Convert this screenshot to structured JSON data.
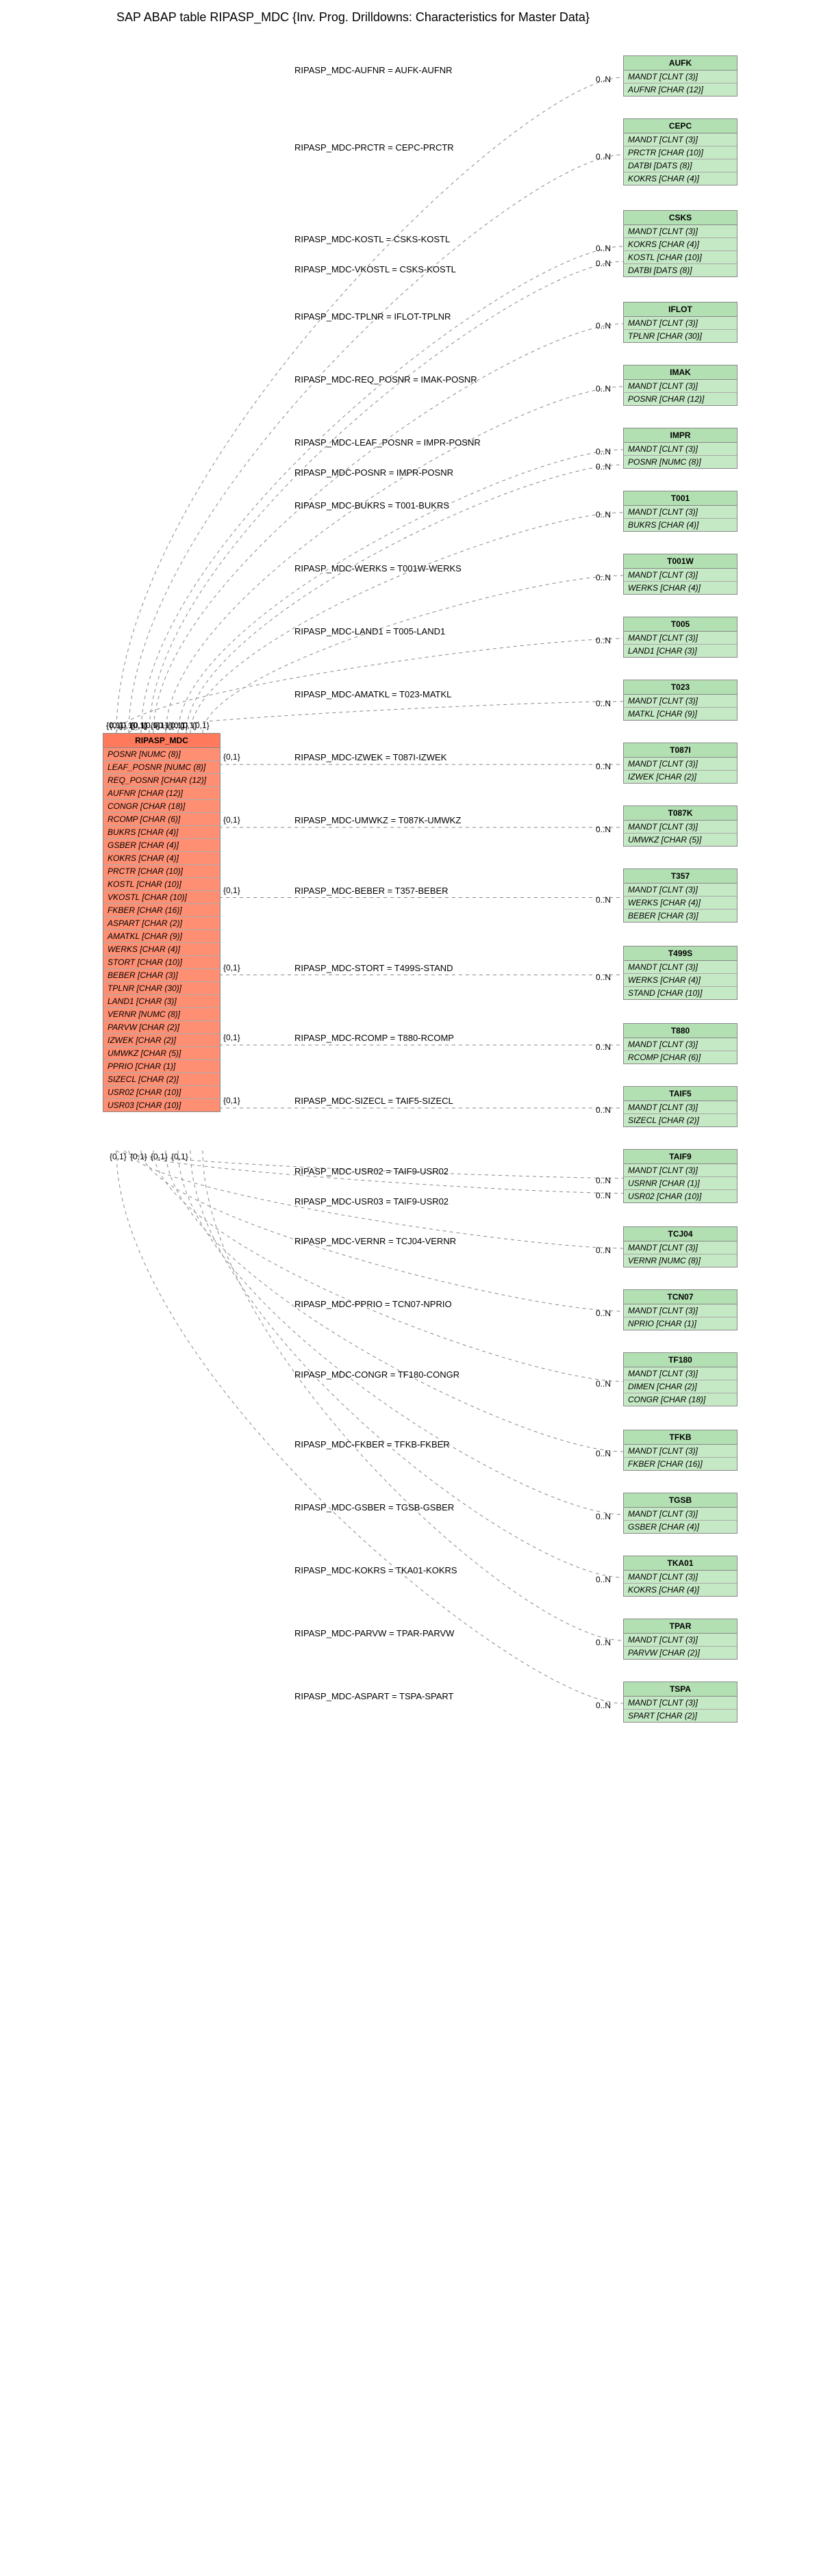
{
  "title": "SAP ABAP table RIPASP_MDC {Inv. Prog. Drilldowns: Characteristics for Master Data}",
  "main_entity": {
    "name": "RIPASP_MDC",
    "fields": [
      "POSNR [NUMC (8)]",
      "LEAF_POSNR [NUMC (8)]",
      "REQ_POSNR [CHAR (12)]",
      "AUFNR [CHAR (12)]",
      "CONGR [CHAR (18)]",
      "RCOMP [CHAR (6)]",
      "BUKRS [CHAR (4)]",
      "GSBER [CHAR (4)]",
      "KOKRS [CHAR (4)]",
      "PRCTR [CHAR (10)]",
      "KOSTL [CHAR (10)]",
      "VKOSTL [CHAR (10)]",
      "FKBER [CHAR (16)]",
      "ASPART [CHAR (2)]",
      "AMATKL [CHAR (9)]",
      "WERKS [CHAR (4)]",
      "STORT [CHAR (10)]",
      "BEBER [CHAR (3)]",
      "TPLNR [CHAR (30)]",
      "LAND1 [CHAR (3)]",
      "VERNR [NUMC (8)]",
      "PARVW [CHAR (2)]",
      "IZWEK [CHAR (2)]",
      "UMWKZ [CHAR (5)]",
      "PPRIO [CHAR (1)]",
      "SIZECL [CHAR (2)]",
      "USR02 [CHAR (10)]",
      "USR03 [CHAR (10)]"
    ]
  },
  "targets": [
    {
      "name": "AUFK",
      "fields": [
        "MANDT [CLNT (3)]",
        "AUFNR [CHAR (12)]"
      ],
      "rel": "RIPASP_MDC-AUFNR = AUFK-AUFNR",
      "left_card": "{0,1}",
      "right_card": "0..N",
      "left_card_stack": true
    },
    {
      "name": "CEPC",
      "fields": [
        "MANDT [CLNT (3)]",
        "PRCTR [CHAR (10)]",
        "DATBI [DATS (8)]",
        "KOKRS [CHAR (4)]"
      ],
      "rel": "RIPASP_MDC-PRCTR = CEPC-PRCTR",
      "left_card": "{0,1}",
      "right_card": "0..N"
    },
    {
      "name": "CSKS",
      "fields": [
        "MANDT [CLNT (3)]",
        "KOKRS [CHAR (4)]",
        "KOSTL [CHAR (10)]",
        "DATBI [DATS (8)]"
      ],
      "rel": "RIPASP_MDC-KOSTL = CSKS-KOSTL",
      "left_card": "{0,1}",
      "right_card": "0..N",
      "second_rel": "RIPASP_MDC-VKOSTL = CSKS-KOSTL",
      "second_right_card": "0..N"
    },
    {
      "name": "IFLOT",
      "fields": [
        "MANDT [CLNT (3)]",
        "TPLNR [CHAR (30)]"
      ],
      "rel": "RIPASP_MDC-TPLNR = IFLOT-TPLNR",
      "left_card": "{0,1}",
      "right_card": "0..N"
    },
    {
      "name": "IMAK",
      "fields": [
        "MANDT [CLNT (3)]",
        "POSNR [CHAR (12)]"
      ],
      "rel": "RIPASP_MDC-REQ_POSNR = IMAK-POSNR",
      "left_card": "{0,1}",
      "right_card": "0..N"
    },
    {
      "name": "IMPR",
      "fields": [
        "MANDT [CLNT (3)]",
        "POSNR [NUMC (8)]"
      ],
      "rel": "RIPASP_MDC-LEAF_POSNR = IMPR-POSNR",
      "left_card": "{0,1}",
      "right_card": "0..N",
      "second_rel": "RIPASP_MDC-POSNR = IMPR-POSNR",
      "second_right_card": "0..N"
    },
    {
      "name": "T001",
      "fields": [
        "MANDT [CLNT (3)]",
        "BUKRS [CHAR (4)]"
      ],
      "rel": "RIPASP_MDC-BUKRS = T001-BUKRS",
      "left_card": "{0,1}",
      "right_card": "0..N"
    },
    {
      "name": "T001W",
      "fields": [
        "MANDT [CLNT (3)]",
        "WERKS [CHAR (4)]"
      ],
      "rel": "RIPASP_MDC-WERKS = T001W-WERKS",
      "left_card": "{0,1}",
      "right_card": "0..N"
    },
    {
      "name": "T005",
      "fields": [
        "MANDT [CLNT (3)]",
        "LAND1 [CHAR (3)]"
      ],
      "rel": "RIPASP_MDC-LAND1 = T005-LAND1",
      "left_card": "{0,1}",
      "right_card": "0..N"
    },
    {
      "name": "T023",
      "fields": [
        "MANDT [CLNT (3)]",
        "MATKL [CHAR (9)]"
      ],
      "rel": "RIPASP_MDC-AMATKL = T023-MATKL",
      "left_card": "{0,1}",
      "right_card": "0..N"
    },
    {
      "name": "T087I",
      "fields": [
        "MANDT [CLNT (3)]",
        "IZWEK [CHAR (2)]"
      ],
      "rel": "RIPASP_MDC-IZWEK = T087I-IZWEK",
      "left_card": "{0,1}",
      "right_card": "0..N"
    },
    {
      "name": "T087K",
      "fields": [
        "MANDT [CLNT (3)]",
        "UMWKZ [CHAR (5)]"
      ],
      "rel": "RIPASP_MDC-UMWKZ = T087K-UMWKZ",
      "left_card": "{0,1}",
      "right_card": "0..N"
    },
    {
      "name": "T357",
      "fields": [
        "MANDT [CLNT (3)]",
        "WERKS [CHAR (4)]",
        "BEBER [CHAR (3)]"
      ],
      "rel": "RIPASP_MDC-BEBER = T357-BEBER",
      "left_card": "{0,1}",
      "right_card": "0..N"
    },
    {
      "name": "T499S",
      "fields": [
        "MANDT [CLNT (3)]",
        "WERKS [CHAR (4)]",
        "STAND [CHAR (10)]"
      ],
      "rel": "RIPASP_MDC-STORT = T499S-STAND",
      "left_card": "{0,1}",
      "right_card": "0..N"
    },
    {
      "name": "T880",
      "fields": [
        "MANDT [CLNT (3)]",
        "RCOMP [CHAR (6)]"
      ],
      "rel": "RIPASP_MDC-RCOMP = T880-RCOMP",
      "left_card": "{0,1}",
      "right_card": "0..N"
    },
    {
      "name": "TAIF5",
      "fields": [
        "MANDT [CLNT (3)]",
        "SIZECL [CHAR (2)]"
      ],
      "rel": "RIPASP_MDC-SIZECL = TAIF5-SIZECL",
      "left_card": "{0,1}",
      "right_card": "0..N"
    },
    {
      "name": "TAIF9",
      "fields": [
        "MANDT [CLNT (3)]",
        "USRNR [CHAR (1)]",
        "USR02 [CHAR (10)]"
      ],
      "rel": "RIPASP_MDC-USR02 = TAIF9-USR02",
      "left_card": "{0,1}",
      "right_card": "0..N",
      "second_rel": "RIPASP_MDC-USR03 = TAIF9-USR02",
      "second_right_card": "0..N"
    },
    {
      "name": "TCJ04",
      "fields": [
        "MANDT [CLNT (3)]",
        "VERNR [NUMC (8)]"
      ],
      "rel": "RIPASP_MDC-VERNR = TCJ04-VERNR",
      "left_card": "{0,1}",
      "right_card": "0..N"
    },
    {
      "name": "TCN07",
      "fields": [
        "MANDT [CLNT (3)]",
        "NPRIO [CHAR (1)]"
      ],
      "rel": "RIPASP_MDC-PPRIO = TCN07-NPRIO",
      "left_card": "{0,1}",
      "right_card": "0..N"
    },
    {
      "name": "TF180",
      "fields": [
        "MANDT [CLNT (3)]",
        "DIMEN [CHAR (2)]",
        "CONGR [CHAR (18)]"
      ],
      "rel": "RIPASP_MDC-CONGR = TF180-CONGR",
      "left_card": "{0,1}",
      "right_card": "0..N"
    },
    {
      "name": "TFKB",
      "fields": [
        "MANDT [CLNT (3)]",
        "FKBER [CHAR (16)]"
      ],
      "rel": "RIPASP_MDC-FKBER = TFKB-FKBER",
      "left_card": "{0,1}",
      "right_card": "0..N"
    },
    {
      "name": "TGSB",
      "fields": [
        "MANDT [CLNT (3)]",
        "GSBER [CHAR (4)]"
      ],
      "rel": "RIPASP_MDC-GSBER = TGSB-GSBER",
      "left_card": "{0,1}",
      "right_card": "0..N"
    },
    {
      "name": "TKA01",
      "fields": [
        "MANDT [CLNT (3)]",
        "KOKRS [CHAR (4)]"
      ],
      "rel": "RIPASP_MDC-KOKRS = TKA01-KOKRS",
      "left_card": "{0,1}",
      "right_card": "0..N"
    },
    {
      "name": "TPAR",
      "fields": [
        "MANDT [CLNT (3)]",
        "PARVW [CHAR (2)]"
      ],
      "rel": "RIPASP_MDC-PARVW = TPAR-PARVW",
      "left_card": "{0,1}",
      "right_card": "0..N"
    },
    {
      "name": "TSPA",
      "fields": [
        "MANDT [CLNT (3)]",
        "SPART [CHAR (2)]"
      ],
      "rel": "RIPASP_MDC-ASPART = TSPA-SPART",
      "left_card": "{0,1}",
      "right_card": "0..N"
    }
  ]
}
